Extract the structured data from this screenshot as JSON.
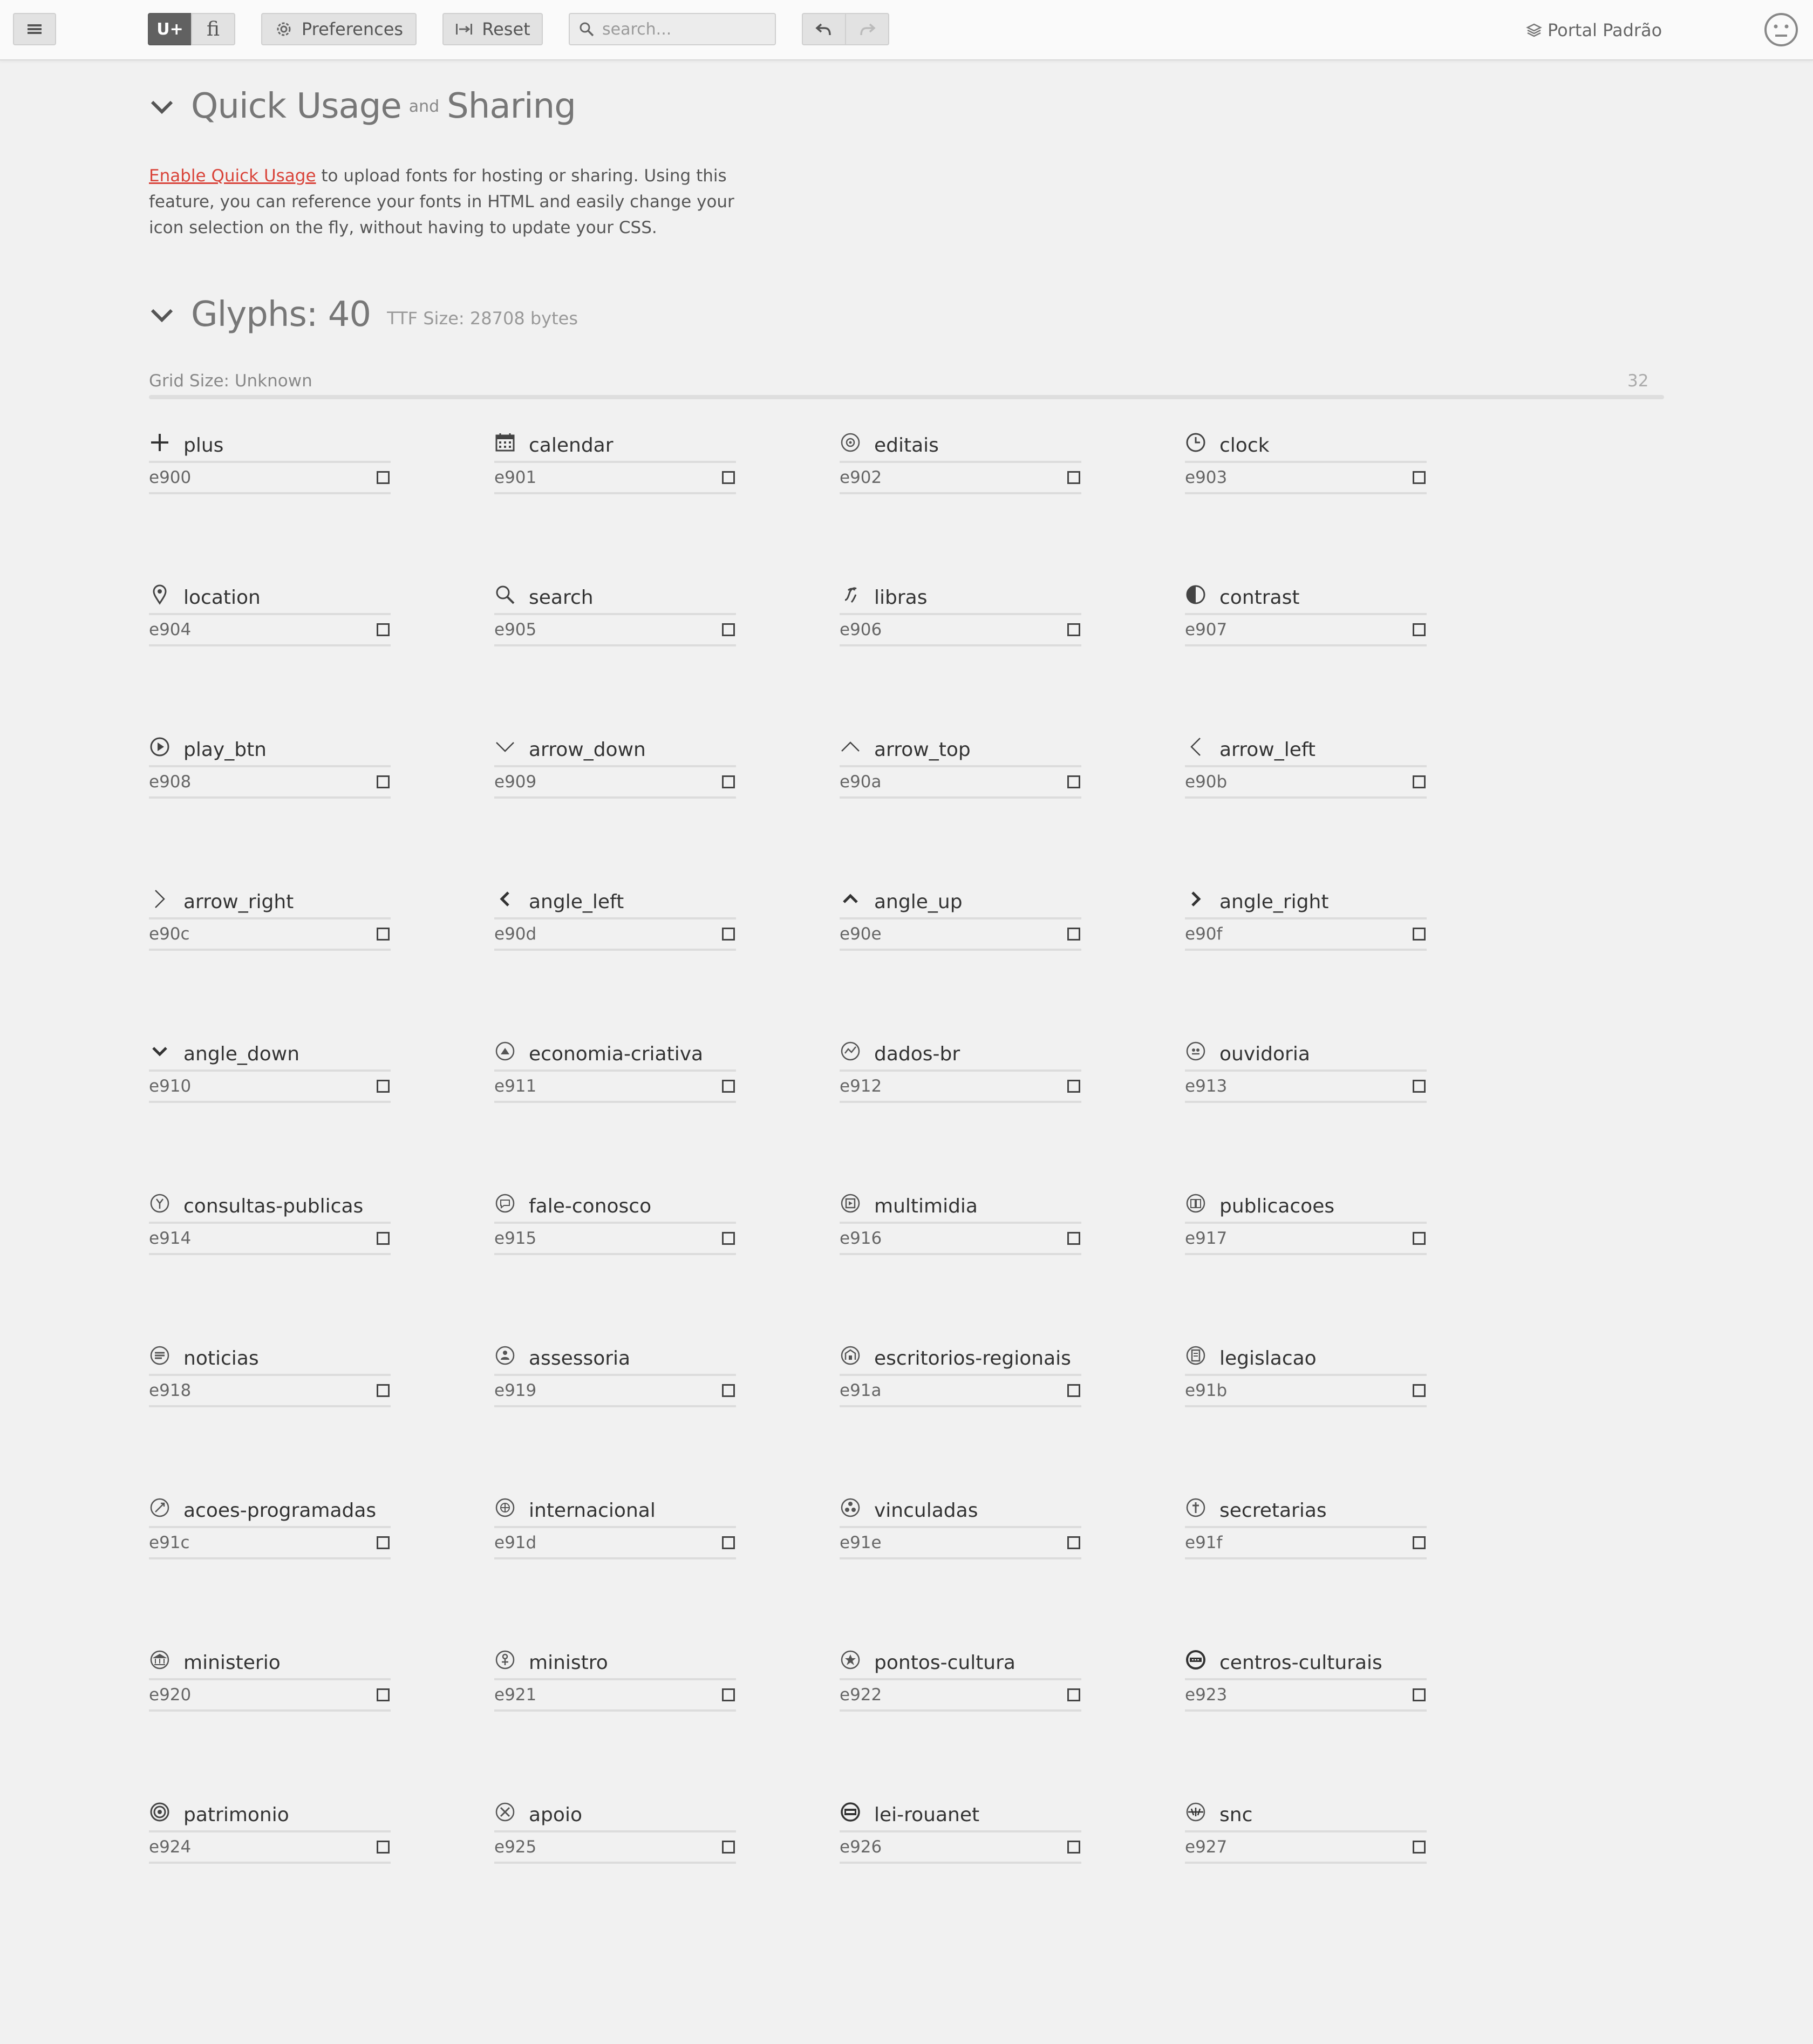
{
  "toolbar": {
    "unicode_label": "U+",
    "ligature_label": "ﬁ",
    "preferences_label": "Preferences",
    "reset_label": "Reset",
    "search_placeholder": "search...",
    "project_name": "Portal Padrão"
  },
  "quick_usage": {
    "title_a": "Quick Usage",
    "title_and": "and",
    "title_b": "Sharing",
    "link_text": "Enable Quick Usage",
    "body_text": " to upload fonts for hosting or sharing. Using this feature, you can reference your fonts in HTML and easily change your icon selection on the fly, without having to update your CSS."
  },
  "glyph_section": {
    "title": "Glyphs: 40",
    "ttf_size": "TTF Size: 28708 bytes",
    "grid_size": "Grid Size: Unknown",
    "grid_value": "32"
  },
  "glyphs": [
    {
      "name": "plus",
      "code": "e900",
      "icon": "plus-icon"
    },
    {
      "name": "calendar",
      "code": "e901",
      "icon": "calendar-icon"
    },
    {
      "name": "editais",
      "code": "e902",
      "icon": "editais-icon"
    },
    {
      "name": "clock",
      "code": "e903",
      "icon": "clock-icon"
    },
    {
      "name": "location",
      "code": "e904",
      "icon": "location-icon"
    },
    {
      "name": "search",
      "code": "e905",
      "icon": "search-icon"
    },
    {
      "name": "libras",
      "code": "e906",
      "icon": "libras-icon"
    },
    {
      "name": "contrast",
      "code": "e907",
      "icon": "contrast-icon"
    },
    {
      "name": "play_btn",
      "code": "e908",
      "icon": "play-icon"
    },
    {
      "name": "arrow_down",
      "code": "e909",
      "icon": "arrow-down-icon"
    },
    {
      "name": "arrow_top",
      "code": "e90a",
      "icon": "arrow-top-icon"
    },
    {
      "name": "arrow_left",
      "code": "e90b",
      "icon": "arrow-left-icon"
    },
    {
      "name": "arrow_right",
      "code": "e90c",
      "icon": "arrow-right-icon"
    },
    {
      "name": "angle_left",
      "code": "e90d",
      "icon": "angle-left-icon"
    },
    {
      "name": "angle_up",
      "code": "e90e",
      "icon": "angle-up-icon"
    },
    {
      "name": "angle_right",
      "code": "e90f",
      "icon": "angle-right-icon"
    },
    {
      "name": "angle_down",
      "code": "e910",
      "icon": "angle-down-icon"
    },
    {
      "name": "economia-criativa",
      "code": "e911",
      "icon": "economia-criativa-icon"
    },
    {
      "name": "dados-br",
      "code": "e912",
      "icon": "dados-br-icon"
    },
    {
      "name": "ouvidoria",
      "code": "e913",
      "icon": "ouvidoria-icon"
    },
    {
      "name": "consultas-publicas",
      "code": "e914",
      "icon": "consultas-publicas-icon"
    },
    {
      "name": "fale-conosco",
      "code": "e915",
      "icon": "fale-conosco-icon"
    },
    {
      "name": "multimidia",
      "code": "e916",
      "icon": "multimidia-icon"
    },
    {
      "name": "publicacoes",
      "code": "e917",
      "icon": "publicacoes-icon"
    },
    {
      "name": "noticias",
      "code": "e918",
      "icon": "noticias-icon"
    },
    {
      "name": "assessoria",
      "code": "e919",
      "icon": "assessoria-icon"
    },
    {
      "name": "escritorios-regionais",
      "code": "e91a",
      "icon": "escritorios-regionais-icon"
    },
    {
      "name": "legislacao",
      "code": "e91b",
      "icon": "legislacao-icon"
    },
    {
      "name": "acoes-programadas",
      "code": "e91c",
      "icon": "acoes-programadas-icon"
    },
    {
      "name": "internacional",
      "code": "e91d",
      "icon": "internacional-icon"
    },
    {
      "name": "vinculadas",
      "code": "e91e",
      "icon": "vinculadas-icon"
    },
    {
      "name": "secretarias",
      "code": "e91f",
      "icon": "secretarias-icon"
    },
    {
      "name": "ministerio",
      "code": "e920",
      "icon": "ministerio-icon"
    },
    {
      "name": "ministro",
      "code": "e921",
      "icon": "ministro-icon"
    },
    {
      "name": "pontos-cultura",
      "code": "e922",
      "icon": "pontos-cultura-icon"
    },
    {
      "name": "centros-culturais",
      "code": "e923",
      "icon": "centros-culturais-icon"
    },
    {
      "name": "patrimonio",
      "code": "e924",
      "icon": "patrimonio-icon"
    },
    {
      "name": "apoio",
      "code": "e925",
      "icon": "apoio-icon"
    },
    {
      "name": "lei-rouanet",
      "code": "e926",
      "icon": "lei-rouanet-icon"
    },
    {
      "name": "snc",
      "code": "e927",
      "icon": "snc-icon"
    }
  ]
}
